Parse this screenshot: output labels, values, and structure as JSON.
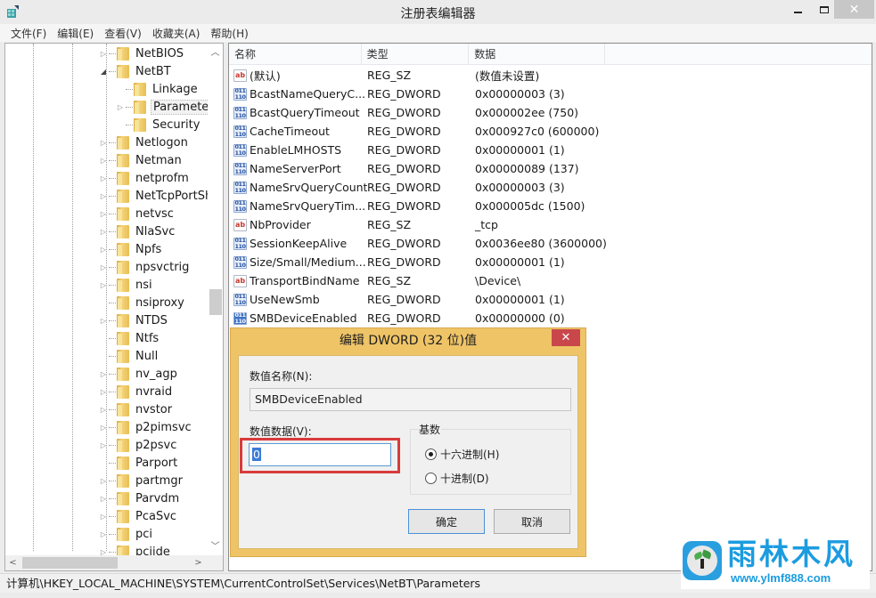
{
  "window": {
    "title": "注册表编辑器",
    "app_icon": "regedit-icon",
    "controls": {
      "minimize": "minimize-icon",
      "maximize": "maximize-icon",
      "close": "✕"
    }
  },
  "menu": [
    {
      "label": "文件(F)"
    },
    {
      "label": "编辑(E)"
    },
    {
      "label": "查看(V)"
    },
    {
      "label": "收藏夹(A)"
    },
    {
      "label": "帮助(H)"
    }
  ],
  "tree": {
    "items": [
      {
        "label": "NetBIOS",
        "level": 0,
        "expander": "collapsed"
      },
      {
        "label": "NetBT",
        "level": 0,
        "expander": "expanded"
      },
      {
        "label": "Linkage",
        "level": 1,
        "expander": "none"
      },
      {
        "label": "Parameters",
        "level": 1,
        "expander": "collapsed",
        "selected": true
      },
      {
        "label": "Security",
        "level": 1,
        "expander": "none"
      },
      {
        "label": "Netlogon",
        "level": 0,
        "expander": "collapsed"
      },
      {
        "label": "Netman",
        "level": 0,
        "expander": "collapsed"
      },
      {
        "label": "netprofm",
        "level": 0,
        "expander": "collapsed"
      },
      {
        "label": "NetTcpPortSha",
        "level": 0,
        "expander": "collapsed"
      },
      {
        "label": "netvsc",
        "level": 0,
        "expander": "collapsed"
      },
      {
        "label": "NlaSvc",
        "level": 0,
        "expander": "collapsed"
      },
      {
        "label": "Npfs",
        "level": 0,
        "expander": "collapsed"
      },
      {
        "label": "npsvctrig",
        "level": 0,
        "expander": "collapsed"
      },
      {
        "label": "nsi",
        "level": 0,
        "expander": "collapsed"
      },
      {
        "label": "nsiproxy",
        "level": 0,
        "expander": "none"
      },
      {
        "label": "NTDS",
        "level": 0,
        "expander": "collapsed"
      },
      {
        "label": "Ntfs",
        "level": 0,
        "expander": "none"
      },
      {
        "label": "Null",
        "level": 0,
        "expander": "none"
      },
      {
        "label": "nv_agp",
        "level": 0,
        "expander": "collapsed"
      },
      {
        "label": "nvraid",
        "level": 0,
        "expander": "collapsed"
      },
      {
        "label": "nvstor",
        "level": 0,
        "expander": "collapsed"
      },
      {
        "label": "p2pimsvc",
        "level": 0,
        "expander": "collapsed"
      },
      {
        "label": "p2psvc",
        "level": 0,
        "expander": "collapsed"
      },
      {
        "label": "Parport",
        "level": 0,
        "expander": "none"
      },
      {
        "label": "partmgr",
        "level": 0,
        "expander": "collapsed"
      },
      {
        "label": "Parvdm",
        "level": 0,
        "expander": "collapsed"
      },
      {
        "label": "PcaSvc",
        "level": 0,
        "expander": "collapsed"
      },
      {
        "label": "pci",
        "level": 0,
        "expander": "collapsed"
      },
      {
        "label": "pciide",
        "level": 0,
        "expander": "collapsed"
      }
    ],
    "scroll": {
      "up": "▲",
      "down": "▼",
      "left": "<",
      "right": ">"
    }
  },
  "list": {
    "columns": [
      "名称",
      "类型",
      "数据"
    ],
    "rows": [
      {
        "icon": "sz",
        "name": "(默认)",
        "type": "REG_SZ",
        "data": "(数值未设置)"
      },
      {
        "icon": "dword",
        "name": "BcastNameQueryC...",
        "type": "REG_DWORD",
        "data": "0x00000003 (3)"
      },
      {
        "icon": "dword",
        "name": "BcastQueryTimeout",
        "type": "REG_DWORD",
        "data": "0x000002ee (750)"
      },
      {
        "icon": "dword",
        "name": "CacheTimeout",
        "type": "REG_DWORD",
        "data": "0x000927c0 (600000)"
      },
      {
        "icon": "dword",
        "name": "EnableLMHOSTS",
        "type": "REG_DWORD",
        "data": "0x00000001 (1)"
      },
      {
        "icon": "dword",
        "name": "NameServerPort",
        "type": "REG_DWORD",
        "data": "0x00000089 (137)"
      },
      {
        "icon": "dword",
        "name": "NameSrvQueryCount",
        "type": "REG_DWORD",
        "data": "0x00000003 (3)"
      },
      {
        "icon": "dword",
        "name": "NameSrvQueryTim...",
        "type": "REG_DWORD",
        "data": "0x000005dc (1500)"
      },
      {
        "icon": "sz",
        "name": "NbProvider",
        "type": "REG_SZ",
        "data": "_tcp"
      },
      {
        "icon": "dword",
        "name": "SessionKeepAlive",
        "type": "REG_DWORD",
        "data": "0x0036ee80 (3600000)"
      },
      {
        "icon": "dword",
        "name": "Size/Small/Medium...",
        "type": "REG_DWORD",
        "data": "0x00000001 (1)"
      },
      {
        "icon": "sz",
        "name": "TransportBindName",
        "type": "REG_SZ",
        "data": "\\Device\\"
      },
      {
        "icon": "dword",
        "name": "UseNewSmb",
        "type": "REG_DWORD",
        "data": "0x00000001 (1)"
      },
      {
        "icon": "dword",
        "name": "SMBDeviceEnabled",
        "type": "REG_DWORD",
        "data": "0x00000000 (0)",
        "selected": true
      }
    ],
    "icon_glyphs": {
      "sz": "ab",
      "dword": "011 110"
    }
  },
  "dialog": {
    "title": "编辑 DWORD (32 位)值",
    "close": "✕",
    "value_name_label": "数值名称(N):",
    "value_name": "SMBDeviceEnabled",
    "value_data_label": "数值数据(V):",
    "value_data": "0",
    "radix_label": "基数",
    "radix_options": [
      {
        "label": "十六进制(H)",
        "checked": true
      },
      {
        "label": "十进制(D)",
        "checked": false
      }
    ],
    "ok": "确定",
    "cancel": "取消",
    "highlight_color": "#d93b3b"
  },
  "statusbar": {
    "path": "计算机\\HKEY_LOCAL_MACHINE\\SYSTEM\\CurrentControlSet\\Services\\NetBT\\Parameters"
  },
  "watermark": {
    "title": "雨林木风",
    "url": "www.ylmf888.com",
    "color": "#1b9ce0"
  }
}
